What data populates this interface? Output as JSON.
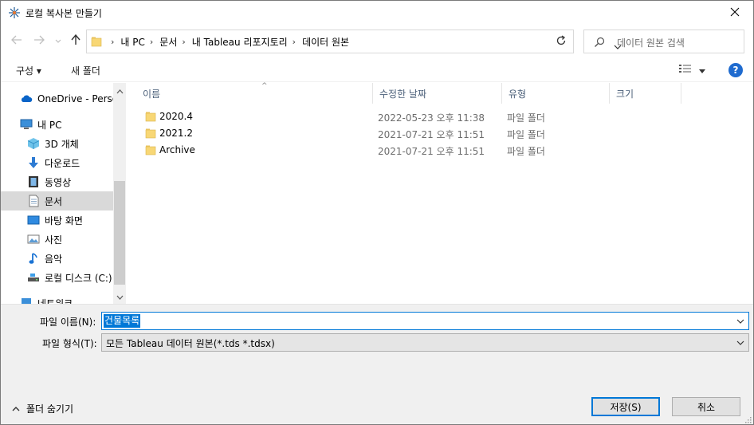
{
  "window": {
    "title": "로컬 복사본 만들기",
    "icon": "tableau-logo-icon"
  },
  "address": {
    "crumbs": [
      "내 PC",
      "문서",
      "내 Tableau 리포지토리",
      "데이터 원본"
    ]
  },
  "search": {
    "placeholder": "데이터 원본 검색"
  },
  "toolbar": {
    "organize_label": "구성 ▾",
    "new_folder_label": "새 폴더",
    "help_label": "?"
  },
  "navpane": {
    "items": [
      {
        "label": "OneDrive - Personal",
        "icon": "onedrive-icon"
      },
      {
        "label": "내 PC",
        "icon": "pc-icon"
      },
      {
        "label": "3D 개체",
        "icon": "3d-objects-icon"
      },
      {
        "label": "다운로드",
        "icon": "download-icon"
      },
      {
        "label": "동영상",
        "icon": "video-icon"
      },
      {
        "label": "문서",
        "icon": "document-icon",
        "selected": true
      },
      {
        "label": "바탕 화면",
        "icon": "desktop-icon"
      },
      {
        "label": "사진",
        "icon": "pictures-icon"
      },
      {
        "label": "음악",
        "icon": "music-icon"
      },
      {
        "label": "로컬 디스크 (C:)",
        "icon": "drive-icon"
      },
      {
        "label": "네트워크",
        "icon": "network-icon"
      }
    ]
  },
  "filelist": {
    "columns": [
      "이름",
      "수정한 날짜",
      "유형",
      "크기"
    ],
    "rows": [
      {
        "name": "2020.4",
        "modified": "2022-05-23 오후 11:38",
        "type": "파일 폴더",
        "size": ""
      },
      {
        "name": "2021.2",
        "modified": "2021-07-21 오후 11:51",
        "type": "파일 폴더",
        "size": ""
      },
      {
        "name": "Archive",
        "modified": "2021-07-21 오후 11:51",
        "type": "파일 폴더",
        "size": ""
      }
    ]
  },
  "form": {
    "filename_label": "파일 이름(N):",
    "filename_value": "건물목록",
    "filetype_label": "파일 형식(T):",
    "filetype_value": "모든 Tableau 데이터 원본(*.tds *.tdsx)"
  },
  "footer": {
    "hide_folders_label": "폴더 숨기기",
    "save_label": "저장(S)",
    "cancel_label": "취소"
  },
  "colors": {
    "accent": "#0078d7",
    "folder": "#f8d775",
    "help": "#1f6bcf"
  }
}
